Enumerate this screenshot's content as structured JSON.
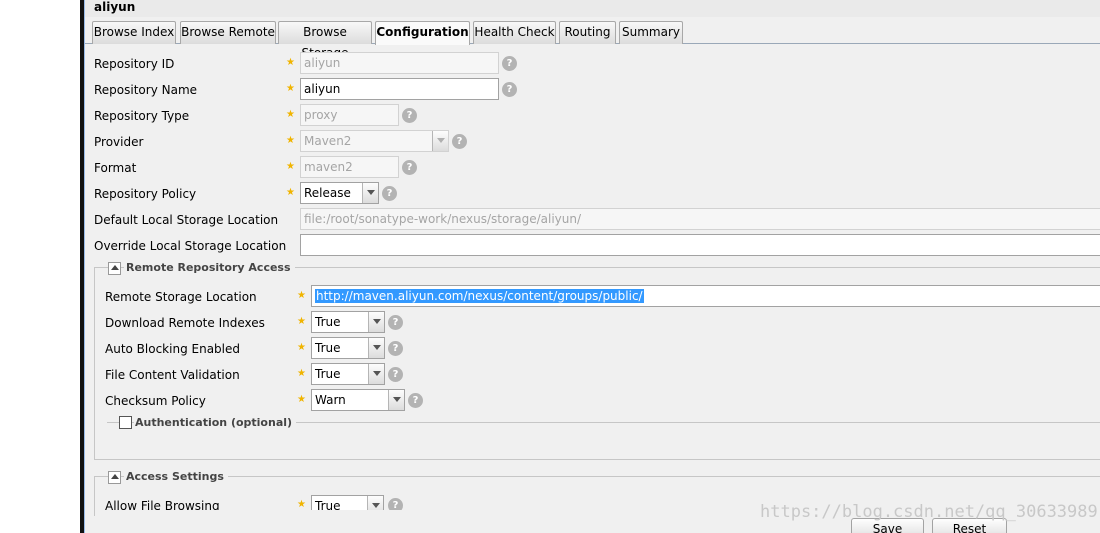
{
  "window": {
    "title": "aliyun"
  },
  "tabs": [
    {
      "label": "Browse Index",
      "active": false
    },
    {
      "label": "Browse Remote",
      "active": false
    },
    {
      "label": "Browse Storage",
      "active": false
    },
    {
      "label": "Configuration",
      "active": true
    },
    {
      "label": "Health Check",
      "active": false
    },
    {
      "label": "Routing",
      "active": false
    },
    {
      "label": "Summary",
      "active": false
    }
  ],
  "form": {
    "repository_id": {
      "label": "Repository ID",
      "value": "aliyun"
    },
    "repository_name": {
      "label": "Repository Name",
      "value": "aliyun"
    },
    "repository_type": {
      "label": "Repository Type",
      "value": "proxy"
    },
    "provider": {
      "label": "Provider",
      "value": "Maven2"
    },
    "format": {
      "label": "Format",
      "value": "maven2"
    },
    "repository_policy": {
      "label": "Repository Policy",
      "value": "Release"
    },
    "default_storage": {
      "label": "Default Local Storage Location",
      "value": "file:/root/sonatype-work/nexus/storage/aliyun/"
    },
    "override_storage": {
      "label": "Override Local Storage Location",
      "value": ""
    }
  },
  "remote": {
    "legend": "Remote Repository Access",
    "remote_location": {
      "label": "Remote Storage Location",
      "value": "http://maven.aliyun.com/nexus/content/groups/public/"
    },
    "download_indexes": {
      "label": "Download Remote Indexes",
      "value": "True"
    },
    "auto_blocking": {
      "label": "Auto Blocking Enabled",
      "value": "True"
    },
    "content_validation": {
      "label": "File Content Validation",
      "value": "True"
    },
    "checksum_policy": {
      "label": "Checksum Policy",
      "value": "Warn"
    },
    "auth_legend": "Authentication (optional)"
  },
  "access": {
    "legend": "Access Settings",
    "allow_browsing": {
      "label": "Allow File Browsing",
      "value": "True"
    }
  },
  "buttons": {
    "save": "Save",
    "reset": "Reset"
  },
  "watermark": "https://blog.csdn.net/qq_30633989",
  "icons": {
    "help": "help-icon",
    "required": "required-star-icon",
    "dropdown": "chevron-down-icon"
  },
  "colors": {
    "required_star": "#f0b400",
    "selection": "#3399ff",
    "panel_bg": "#f0f0f0"
  }
}
